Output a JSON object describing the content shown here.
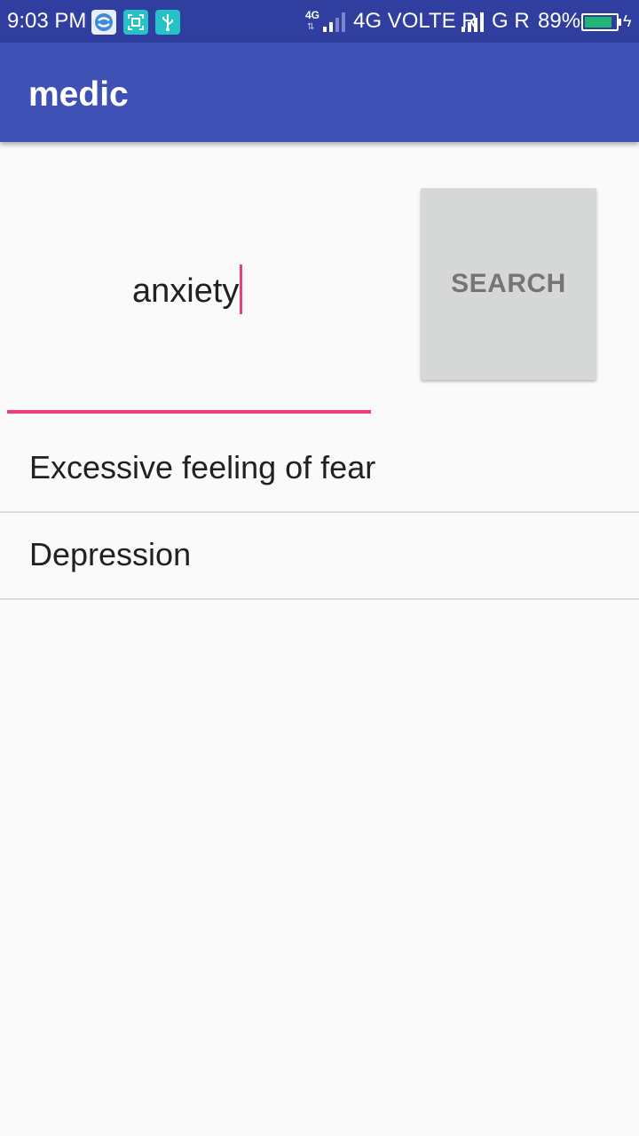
{
  "status_bar": {
    "time": "9:03 PM",
    "icons": [
      "sync-icon",
      "screenshot-icon",
      "usb-icon"
    ],
    "network_small": "4G",
    "network_arrows": "⇅",
    "network_1": "4G VOLTE R",
    "network_2": "G R",
    "battery_percent": "89%",
    "battery_level": 0.89
  },
  "app_bar": {
    "title": "medic"
  },
  "search": {
    "value": "anxiety",
    "button_label": "SEARCH"
  },
  "results": {
    "items": [
      {
        "label": "Excessive feeling of fear"
      },
      {
        "label": "Depression"
      }
    ]
  },
  "colors": {
    "status_bar": "#303f9f",
    "app_bar": "#3f51b5",
    "accent": "#ec407a",
    "button_bg": "#d6d7d7",
    "background": "#fafafa"
  }
}
